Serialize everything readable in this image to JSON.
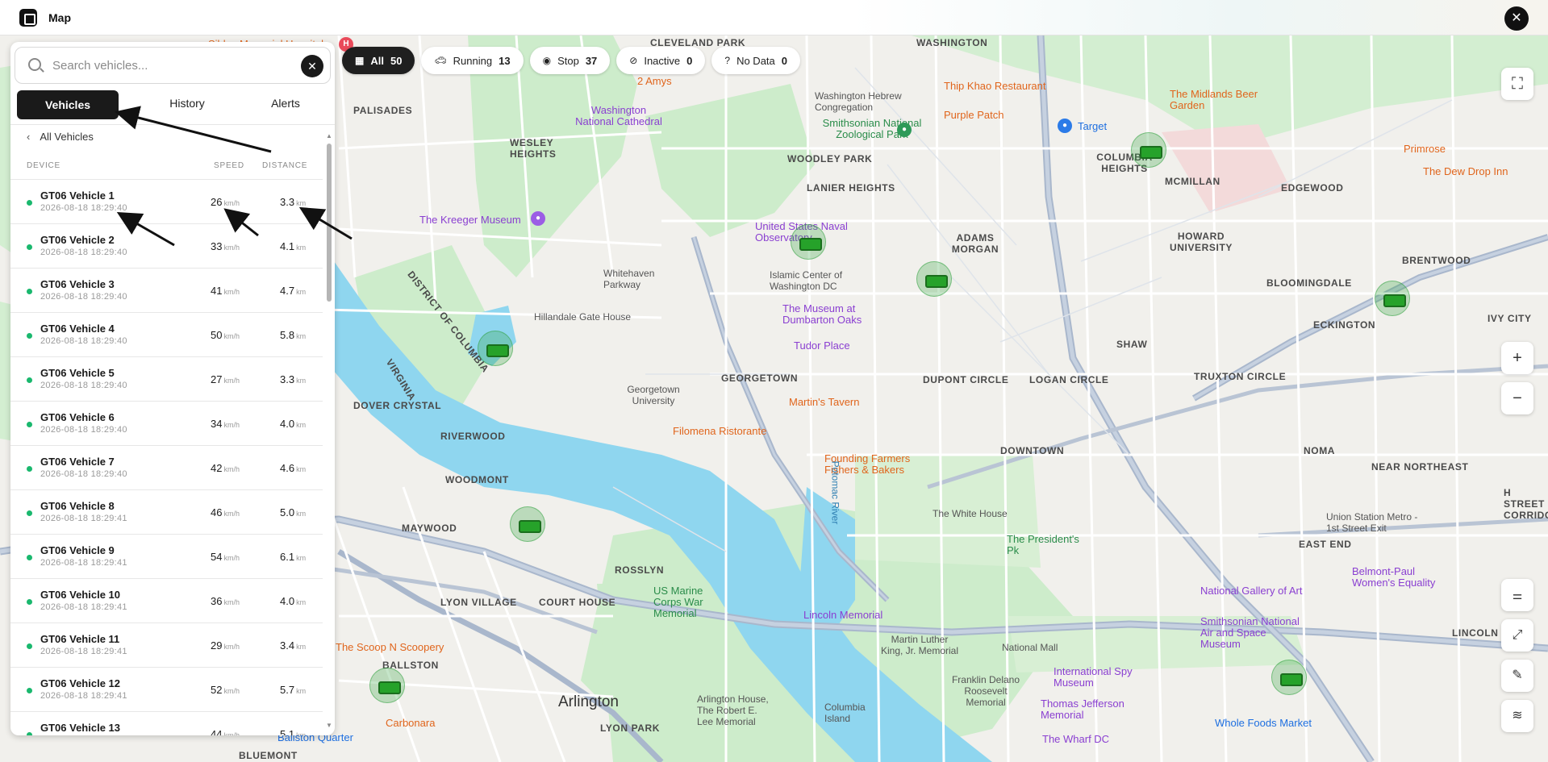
{
  "app": {
    "title": "Map"
  },
  "search": {
    "placeholder": "Search vehicles..."
  },
  "tabs": [
    {
      "label": "Vehicles"
    },
    {
      "label": "History"
    },
    {
      "label": "Alerts"
    }
  ],
  "back_label": "All Vehicles",
  "columns": {
    "device": "DEVICE",
    "speed": "SPEED",
    "distance": "DISTANCE"
  },
  "units": {
    "speed": "km/h",
    "distance": "km"
  },
  "vehicles": [
    {
      "name": "GT06 Vehicle 1",
      "ts": "2026-08-18 18:29:40",
      "speed": "26",
      "distance": "3.3"
    },
    {
      "name": "GT06 Vehicle 2",
      "ts": "2026-08-18 18:29:40",
      "speed": "33",
      "distance": "4.1"
    },
    {
      "name": "GT06 Vehicle 3",
      "ts": "2026-08-18 18:29:40",
      "speed": "41",
      "distance": "4.7"
    },
    {
      "name": "GT06 Vehicle 4",
      "ts": "2026-08-18 18:29:40",
      "speed": "50",
      "distance": "5.8"
    },
    {
      "name": "GT06 Vehicle 5",
      "ts": "2026-08-18 18:29:40",
      "speed": "27",
      "distance": "3.3"
    },
    {
      "name": "GT06 Vehicle 6",
      "ts": "2026-08-18 18:29:40",
      "speed": "34",
      "distance": "4.0"
    },
    {
      "name": "GT06 Vehicle 7",
      "ts": "2026-08-18 18:29:40",
      "speed": "42",
      "distance": "4.6"
    },
    {
      "name": "GT06 Vehicle 8",
      "ts": "2026-08-18 18:29:41",
      "speed": "46",
      "distance": "5.0"
    },
    {
      "name": "GT06 Vehicle 9",
      "ts": "2026-08-18 18:29:41",
      "speed": "54",
      "distance": "6.1"
    },
    {
      "name": "GT06 Vehicle 10",
      "ts": "2026-08-18 18:29:41",
      "speed": "36",
      "distance": "4.0"
    },
    {
      "name": "GT06 Vehicle 11",
      "ts": "2026-08-18 18:29:41",
      "speed": "29",
      "distance": "3.4"
    },
    {
      "name": "GT06 Vehicle 12",
      "ts": "2026-08-18 18:29:41",
      "speed": "52",
      "distance": "5.7"
    },
    {
      "name": "GT06 Vehicle 13",
      "ts": "",
      "speed": "44",
      "distance": "5.1"
    }
  ],
  "filters": [
    {
      "label": "All",
      "count": "50",
      "icon": "grid-icon"
    },
    {
      "label": "Running",
      "count": "13",
      "icon": "car-icon"
    },
    {
      "label": "Stop",
      "count": "37",
      "icon": "pin-icon"
    },
    {
      "label": "Inactive",
      "count": "0",
      "icon": "slash-icon"
    },
    {
      "label": "No Data",
      "count": "0",
      "icon": "question-icon"
    }
  ],
  "map": {
    "areas": [
      "WASHINGTON",
      "PALISADES",
      "WESLEY HEIGHTS",
      "CLEVELAND PARK",
      "WOODLEY PARK",
      "LANIER HEIGHTS",
      "ADAMS MORGAN",
      "COLUMBIA HEIGHTS",
      "MCMILLAN",
      "HOWARD UNIVERSITY",
      "EDGEWOOD",
      "BRENTWOOD",
      "BLOOMINGDALE",
      "ECKINGTON",
      "IVY CITY",
      "SHAW",
      "TRUXTON CIRCLE",
      "LOGAN CIRCLE",
      "DUPONT CIRCLE",
      "GEORGETOWN",
      "DOVER CRYSTAL",
      "RIVERWOOD",
      "WOODMONT",
      "MAYWOOD",
      "ROSSLYN",
      "LYON VILLAGE",
      "COURT HOUSE",
      "DOWNTOWN",
      "NOMA",
      "NEAR NORTHEAST",
      "H STREET CORRIDOR",
      "EAST END",
      "LINCOLN PARK",
      "BALLSTON",
      "LYON PARK",
      "BLUEMONT",
      "Arlington",
      "DISTRICT OF COLUMBIA",
      "VIRGINIA"
    ],
    "pois": [
      "Sibley Memorial Hospital",
      "2 Amys",
      "Washington National Cathedral",
      "Washington Hebrew Congregation",
      "Smithsonian National Zoological Park",
      "Thip Khao Restaurant",
      "Purple Patch",
      "The Midlands Beer Garden",
      "Target",
      "Primrose",
      "The Dew Drop Inn",
      "The Kreeger Museum",
      "United States Naval Observatory",
      "Islamic Center of Washington DC",
      "The Museum at Dumbarton Oaks",
      "Tudor Place",
      "Whitehaven Parkway",
      "Hillandale Gate House",
      "Georgetown University",
      "Martin's Tavern",
      "Filomena Ristorante",
      "Founding Farmers Fishers & Bakers",
      "The White House",
      "The President's Pk",
      "Union Station Metro - 1st Street Exit",
      "Belmont-Paul Women's Equality",
      "National Gallery of Art",
      "Smithsonian National Air and Space Museum",
      "Lincoln Memorial",
      "Martin Luther King, Jr. Memorial",
      "National Mall",
      "Franklin Delano Roosevelt Memorial",
      "International Spy Museum",
      "Thomas Jefferson Memorial",
      "The Wharf DC",
      "Whole Foods Market",
      "US Marine Corps War Memorial",
      "Arlington House, The Robert E. Lee Memorial",
      "Columbia Island",
      "The Scoop N Scoopery",
      "Carbonara",
      "Ballston Quarter",
      "Potomac River"
    ]
  },
  "colors": {
    "accent": "#1a1a1a",
    "status_online": "#1ab86e",
    "vehicle": "#26a22a",
    "water": "#8fd6ef",
    "park": "#cdeccb"
  }
}
